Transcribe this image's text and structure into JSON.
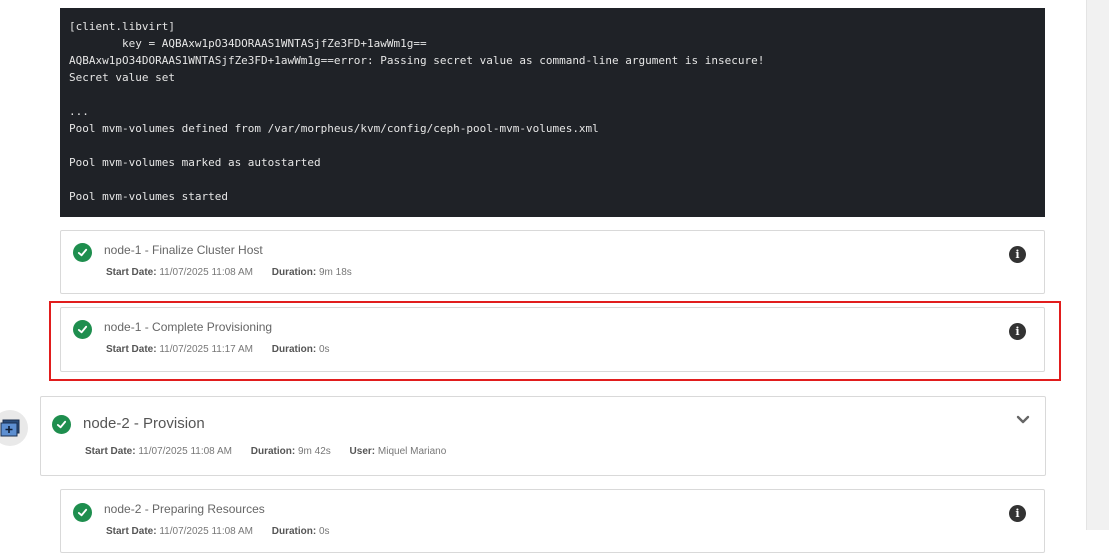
{
  "console": {
    "lines": [
      "[client.libvirt]",
      "        key = AQBAxw1pO34DORAAS1WNTASjfZe3FD+1awWm1g==",
      "AQBAxw1pO34DORAAS1WNTASjfZe3FD+1awWm1g==error: Passing secret value as command-line argument is insecure!",
      "Secret value set",
      "",
      "...",
      "Pool mvm-volumes defined from /var/morpheus/kvm/config/ceph-pool-mvm-volumes.xml",
      "",
      "Pool mvm-volumes marked as autostarted",
      "",
      "Pool mvm-volumes started"
    ]
  },
  "labels": {
    "start_date": "Start Date:",
    "duration": "Duration:",
    "user": "User:"
  },
  "tasks": [
    {
      "title": "node-1 - Finalize Cluster Host",
      "start_date": "11/07/2025 11:08 AM",
      "duration": "9m 18s"
    },
    {
      "title": "node-1 - Complete Provisioning",
      "start_date": "11/07/2025 11:17 AM",
      "duration": "0s"
    },
    {
      "title": "node-2 - Preparing Resources",
      "start_date": "11/07/2025 11:08 AM",
      "duration": "0s"
    }
  ],
  "node2": {
    "title": "node-2 - Provision",
    "start_date": "11/07/2025 11:08 AM",
    "duration": "9m 42s",
    "user": "Miquel Mariano"
  },
  "colors": {
    "success": "#1e8e4e",
    "highlight": "#e11d1d",
    "console_bg": "#1f2227"
  }
}
